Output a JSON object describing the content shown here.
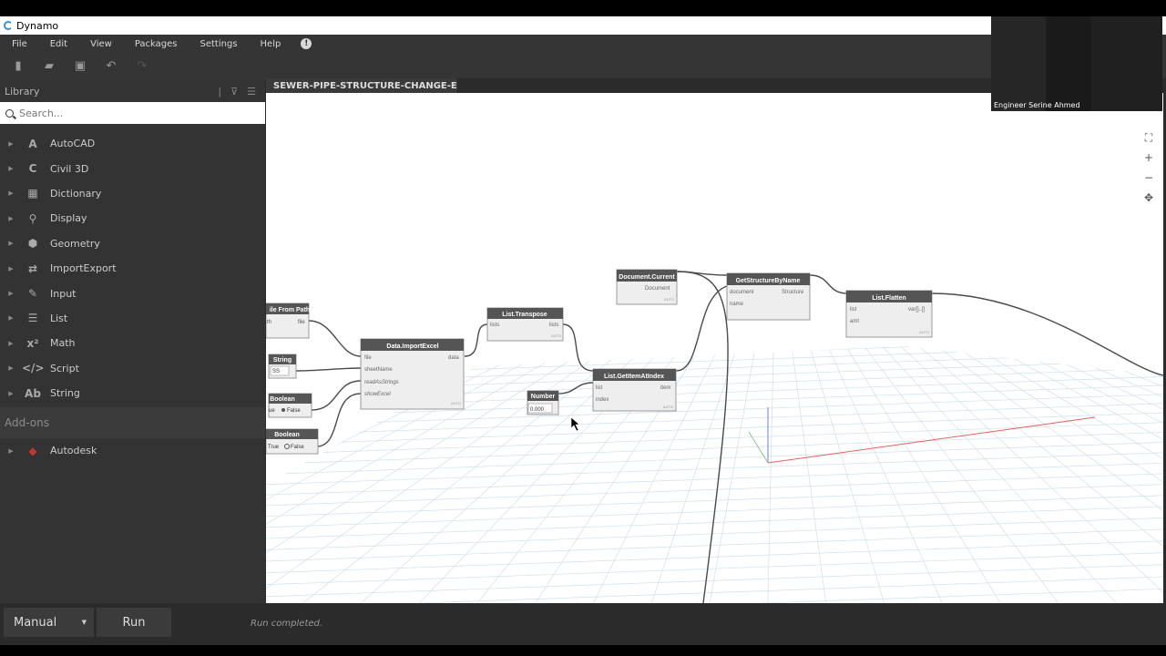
{
  "app": {
    "title": "Dynamo"
  },
  "menu": [
    "File",
    "Edit",
    "View",
    "Packages",
    "Settings",
    "Help"
  ],
  "library": {
    "title": "Library",
    "search_placeholder": "Search...",
    "categories": [
      {
        "label": "AutoCAD",
        "icon": "A"
      },
      {
        "label": "Civil 3D",
        "icon": "C"
      },
      {
        "label": "Dictionary",
        "icon": "▦"
      },
      {
        "label": "Display",
        "icon": "⚲"
      },
      {
        "label": "Geometry",
        "icon": "⬢"
      },
      {
        "label": "ImportExport",
        "icon": "⇄"
      },
      {
        "label": "Input",
        "icon": "✎"
      },
      {
        "label": "List",
        "icon": "☰"
      },
      {
        "label": "Math",
        "icon": "x²"
      },
      {
        "label": "Script",
        "icon": "</>"
      },
      {
        "label": "String",
        "icon": "Ab"
      }
    ],
    "addons_label": "Add-ons",
    "addons": [
      {
        "label": "Autodesk",
        "icon": "◆"
      }
    ]
  },
  "tab": {
    "label": "SEWER-PIPE-STRUCTURE-CHANGE-EXCE",
    "close": "×"
  },
  "webcam": {
    "name": "Engineer Serine Ahmed"
  },
  "run": {
    "mode": "Manual",
    "button": "Run",
    "status": "Run completed."
  },
  "nodes": {
    "filefrompath": {
      "title": "ile From Path",
      "in": "th",
      "out": "file"
    },
    "string": {
      "title": "String",
      "value": "SS"
    },
    "boolean1": {
      "title": "Boolean",
      "true": "ue",
      "false": "False"
    },
    "boolean2": {
      "title": "Boolean",
      "true": "True",
      "false": "False"
    },
    "importexcel": {
      "title": "Data.ImportExcel",
      "inputs": [
        "file",
        "sheetName",
        "readAsStrings",
        "showExcel"
      ],
      "output": "data",
      "foot": "AUTO"
    },
    "transpose": {
      "title": "List.Transpose",
      "input": "lists",
      "output": "lists",
      "foot": "AUTO"
    },
    "number": {
      "title": "Number",
      "value": "0.000"
    },
    "getitem": {
      "title": "List.GetItemAtIndex",
      "inputs": [
        "list",
        "index"
      ],
      "output": "item",
      "foot": "AUTO"
    },
    "doccurrent": {
      "title": "Document.Current",
      "output": "Document",
      "foot": "AUTO"
    },
    "getstructure": {
      "title": "GetStructureByName",
      "inputs": [
        "document",
        "name"
      ],
      "output": "Structure"
    },
    "flatten": {
      "title": "List.Flatten",
      "inputs": [
        "list",
        "amt"
      ],
      "output": "var[]..[]",
      "foot": "AUTO"
    }
  }
}
